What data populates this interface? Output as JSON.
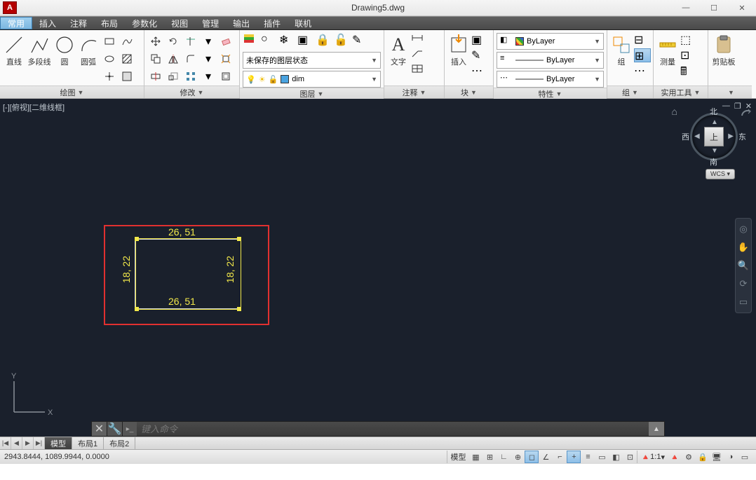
{
  "window": {
    "title": "Drawing5.dwg",
    "logo_letter": "A"
  },
  "menu": {
    "tabs": [
      "常用",
      "插入",
      "注释",
      "布局",
      "参数化",
      "视图",
      "管理",
      "输出",
      "插件",
      "联机"
    ],
    "active_index": 0
  },
  "ribbon": {
    "draw": {
      "title": "绘图",
      "line": "直线",
      "polyline": "多段线",
      "circle": "圆",
      "arc": "圆弧"
    },
    "modify": {
      "title": "修改"
    },
    "layer": {
      "title": "图层",
      "state_placeholder": "未保存的图层状态",
      "current": "dim"
    },
    "annotate": {
      "title": "注释",
      "text": "文字"
    },
    "block": {
      "title": "块",
      "insert": "插入"
    },
    "property": {
      "title": "特性",
      "bylayer1": "ByLayer",
      "bylayer2": "ByLayer",
      "bylayer3": "ByLayer"
    },
    "group": {
      "title": "组",
      "group": "组"
    },
    "utility": {
      "title": "实用工具",
      "measure": "测量"
    },
    "clipboard": {
      "title": "剪贴板",
      "label": "剪贴板"
    }
  },
  "view": {
    "label": "[-][俯视][二维线框]",
    "cube": {
      "north": "北",
      "south": "南",
      "west": "西",
      "east": "东",
      "top": "上"
    },
    "wcs": "WCS"
  },
  "drawing": {
    "dim_horizontal": "26, 51",
    "dim_vertical": "18, 22"
  },
  "ucs": {
    "x": "X",
    "y": "Y"
  },
  "command": {
    "placeholder": "键入命令"
  },
  "layout_tabs": {
    "model": "模型",
    "layout1": "布局1",
    "layout2": "布局2"
  },
  "status": {
    "coords": "2943.8444, 1089.9944, 0.0000",
    "model": "模型",
    "scale": "1:1"
  }
}
